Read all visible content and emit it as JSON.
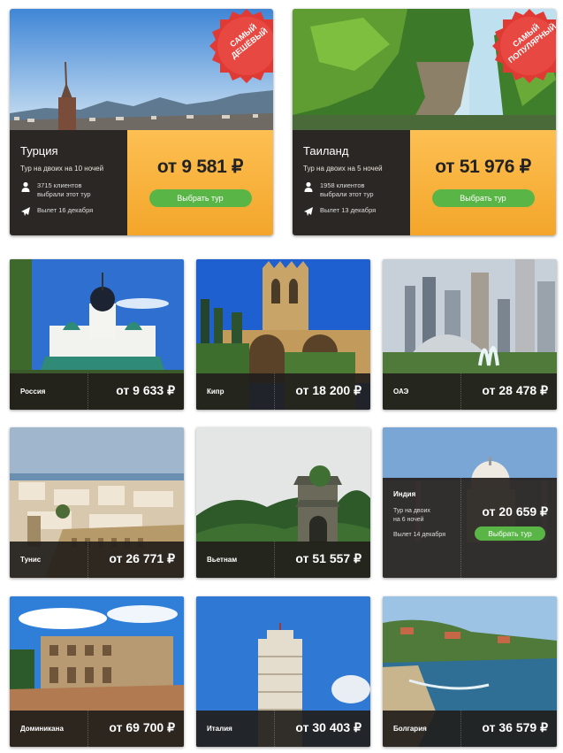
{
  "featured": [
    {
      "country": "Турция",
      "subtitle": "Тур на двоих на 10 ночей",
      "clients": "3715 клиентов",
      "clients_line2": "выбрали этот тур",
      "departure": "Вылет 16 декабря",
      "price": "от 9 581 ₽",
      "button": "Выбрать тур",
      "badge_line1": "САМЫЙ",
      "badge_line2": "ДЕШЁВЫЙ"
    },
    {
      "country": "Таиланд",
      "subtitle": "Тур на двоих на 5 ночей",
      "clients": "1958 клиентов",
      "clients_line2": "выбрали этот тур",
      "departure": "Вылет 13 декабря",
      "price": "от 51 976 ₽",
      "button": "Выбрать тур",
      "badge_line1": "САМЫЙ",
      "badge_line2": "ПОПУЛЯРНЫЙ"
    }
  ],
  "tours": [
    {
      "country": "Россия",
      "price": "от 9 633 ₽"
    },
    {
      "country": "Кипр",
      "price": "от 18 200 ₽"
    },
    {
      "country": "ОАЭ",
      "price": "от 28 478 ₽"
    },
    {
      "country": "Тунис",
      "price": "от 26 771 ₽"
    },
    {
      "country": "Вьетнам",
      "price": "от 51 557 ₽"
    },
    {
      "country": "Индия",
      "price": "от 20 659 ₽",
      "subtitle_line1": "Тур на двоих",
      "subtitle_line2": "на 6 ночей",
      "departure": "Вылет 14 декабря",
      "button": "Выбрать тур"
    },
    {
      "country": "Доминикана",
      "price": "от 69 700 ₽"
    },
    {
      "country": "Италия",
      "price": "от 30 403 ₽"
    },
    {
      "country": "Болгария",
      "price": "от 36 579 ₽"
    }
  ],
  "colors": {
    "accent_orange": "#f7ae35",
    "button_green": "#5ab547",
    "badge_red": "#e03a35",
    "info_dark": "#2b2724"
  },
  "icons": [
    "person-icon",
    "plane-icon"
  ]
}
